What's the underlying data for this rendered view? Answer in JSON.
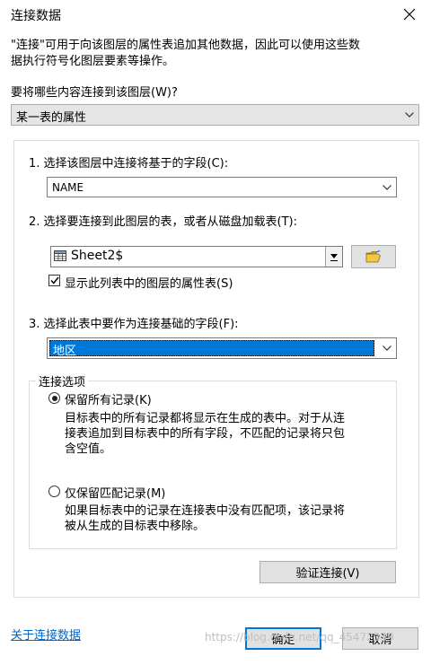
{
  "window": {
    "title": "连接数据"
  },
  "intro": {
    "line1": "\"连接\"可用于向该图层的属性表追加其他数据，因此可以使用这些数",
    "line2": "据执行符号化图层要素等操作。"
  },
  "join_what": {
    "label": "要将哪些内容连接到该图层(W)?",
    "selected": "某一表的属性"
  },
  "step1": {
    "label": "1. 选择该图层中连接将基于的字段(C):",
    "value": "NAME"
  },
  "step2": {
    "label": "2. 选择要连接到此图层的表，或者从磁盘加载表(T):",
    "table_value": "Sheet2$",
    "show_layers_label": "显示此列表中的图层的属性表(S)",
    "show_layers_checked": true
  },
  "step3": {
    "label": "3. 选择此表中要作为连接基础的字段(F):",
    "value": "地区"
  },
  "join_options": {
    "legend": "连接选项",
    "keep_all": {
      "label": "保留所有记录(K)",
      "selected": true,
      "desc_line1": "目标表中的所有记录都将显示在生成的表中。对于从连",
      "desc_line2": "接表追加到目标表中的所有字段，不匹配的记录将只包",
      "desc_line3": "含空值。"
    },
    "keep_matching": {
      "label": "仅保留匹配记录(M)",
      "selected": false,
      "desc_line1": "如果目标表中的记录在连接表中没有匹配项，该记录将",
      "desc_line2": "被从生成的目标表中移除。"
    }
  },
  "validate_label": "验证连接(V)",
  "about_link": "关于连接数据",
  "ok_label": "确定",
  "cancel_label": "取消",
  "watermark": "https://blog.csdn.net/qq_45472339"
}
